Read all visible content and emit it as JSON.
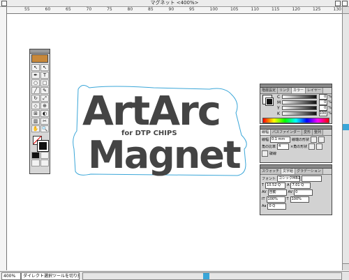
{
  "window": {
    "title": "マグネット <400%>"
  },
  "ruler": {
    "labels": [
      "55",
      "60",
      "65",
      "70",
      "75",
      "80",
      "85",
      "90",
      "95",
      "100",
      "105",
      "110",
      "115",
      "120",
      "125",
      "130"
    ]
  },
  "artwork": {
    "line1": "ArtArc",
    "subtitle": "for DTP CHIPS",
    "line2": "Magnet"
  },
  "toolbox": {
    "tools": [
      "↖",
      "↖",
      "✒",
      "T",
      "○",
      "□",
      "╱",
      "✎",
      "↻",
      "⤢",
      "◇",
      "⊕",
      "⊞",
      "◐",
      "▥",
      "✂",
      "✋",
      "🔍"
    ]
  },
  "color_palette": {
    "tabs": [
      "階層設定",
      "リンク",
      "カラー",
      "レイヤー"
    ],
    "active_tab": "カラー",
    "channels": [
      {
        "label": "C",
        "value": "0"
      },
      {
        "label": "M",
        "value": "0"
      },
      {
        "label": "Y",
        "value": "0"
      },
      {
        "label": "K",
        "value": "100"
      }
    ],
    "unit": "%"
  },
  "stroke_palette": {
    "tabs": [
      "線幅",
      "パスファインダー",
      "変形",
      "整列"
    ],
    "weight_label": "線幅",
    "weight_value": "0.1 mm",
    "join_label": "線端の形状",
    "miter_label": "角の比率",
    "miter_value": "4",
    "angle_label": "×角の形状",
    "dash_label": "破線"
  },
  "char_palette": {
    "tabs": [
      "スウォッチ",
      "文字組",
      "グラデーション"
    ],
    "font_label": "フォント",
    "font_value": "ゴシックMB101",
    "size": "10.52 Q",
    "leading": "7.01 Q",
    "tracking": "自動",
    "kerning": "0",
    "hscale": "100%",
    "vscale": "100%",
    "baseline": "0 Q"
  },
  "status": {
    "zoom": "400%",
    "text": "ダイレクト選択ツールを切り換え"
  },
  "colors": {
    "accent": "#3aa6d8",
    "artwork": "#444444"
  }
}
